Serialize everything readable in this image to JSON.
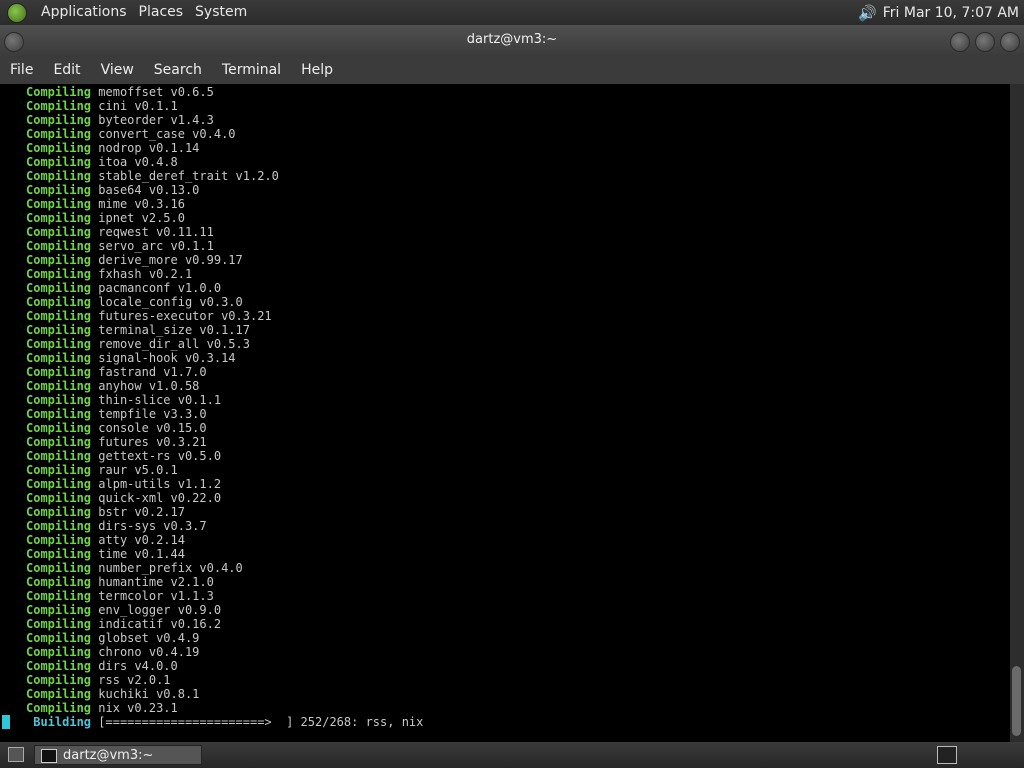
{
  "top_panel": {
    "menus": [
      "Applications",
      "Places",
      "System"
    ],
    "clock": "Fri Mar 10,  7:07 AM"
  },
  "window": {
    "title": "dartz@vm3:~",
    "menus": [
      "File",
      "Edit",
      "View",
      "Search",
      "Terminal",
      "Help"
    ]
  },
  "terminal": {
    "lines": [
      {
        "kw": "Compiling",
        "text": "memoffset v0.6.5"
      },
      {
        "kw": "Compiling",
        "text": "cini v0.1.1"
      },
      {
        "kw": "Compiling",
        "text": "byteorder v1.4.3"
      },
      {
        "kw": "Compiling",
        "text": "convert_case v0.4.0"
      },
      {
        "kw": "Compiling",
        "text": "nodrop v0.1.14"
      },
      {
        "kw": "Compiling",
        "text": "itoa v0.4.8"
      },
      {
        "kw": "Compiling",
        "text": "stable_deref_trait v1.2.0"
      },
      {
        "kw": "Compiling",
        "text": "base64 v0.13.0"
      },
      {
        "kw": "Compiling",
        "text": "mime v0.3.16"
      },
      {
        "kw": "Compiling",
        "text": "ipnet v2.5.0"
      },
      {
        "kw": "Compiling",
        "text": "reqwest v0.11.11"
      },
      {
        "kw": "Compiling",
        "text": "servo_arc v0.1.1"
      },
      {
        "kw": "Compiling",
        "text": "derive_more v0.99.17"
      },
      {
        "kw": "Compiling",
        "text": "fxhash v0.2.1"
      },
      {
        "kw": "Compiling",
        "text": "pacmanconf v1.0.0"
      },
      {
        "kw": "Compiling",
        "text": "locale_config v0.3.0"
      },
      {
        "kw": "Compiling",
        "text": "futures-executor v0.3.21"
      },
      {
        "kw": "Compiling",
        "text": "terminal_size v0.1.17"
      },
      {
        "kw": "Compiling",
        "text": "remove_dir_all v0.5.3"
      },
      {
        "kw": "Compiling",
        "text": "signal-hook v0.3.14"
      },
      {
        "kw": "Compiling",
        "text": "fastrand v1.7.0"
      },
      {
        "kw": "Compiling",
        "text": "anyhow v1.0.58"
      },
      {
        "kw": "Compiling",
        "text": "thin-slice v0.1.1"
      },
      {
        "kw": "Compiling",
        "text": "tempfile v3.3.0"
      },
      {
        "kw": "Compiling",
        "text": "console v0.15.0"
      },
      {
        "kw": "Compiling",
        "text": "futures v0.3.21"
      },
      {
        "kw": "Compiling",
        "text": "gettext-rs v0.5.0"
      },
      {
        "kw": "Compiling",
        "text": "raur v5.0.1"
      },
      {
        "kw": "Compiling",
        "text": "alpm-utils v1.1.2"
      },
      {
        "kw": "Compiling",
        "text": "quick-xml v0.22.0"
      },
      {
        "kw": "Compiling",
        "text": "bstr v0.2.17"
      },
      {
        "kw": "Compiling",
        "text": "dirs-sys v0.3.7"
      },
      {
        "kw": "Compiling",
        "text": "atty v0.2.14"
      },
      {
        "kw": "Compiling",
        "text": "time v0.1.44"
      },
      {
        "kw": "Compiling",
        "text": "number_prefix v0.4.0"
      },
      {
        "kw": "Compiling",
        "text": "humantime v2.1.0"
      },
      {
        "kw": "Compiling",
        "text": "termcolor v1.1.3"
      },
      {
        "kw": "Compiling",
        "text": "env_logger v0.9.0"
      },
      {
        "kw": "Compiling",
        "text": "indicatif v0.16.2"
      },
      {
        "kw": "Compiling",
        "text": "globset v0.4.9"
      },
      {
        "kw": "Compiling",
        "text": "chrono v0.4.19"
      },
      {
        "kw": "Compiling",
        "text": "dirs v4.0.0"
      },
      {
        "kw": "Compiling",
        "text": "rss v2.0.1"
      },
      {
        "kw": "Compiling",
        "text": "kuchiki v0.8.1"
      },
      {
        "kw": "Compiling",
        "text": "nix v0.23.1"
      },
      {
        "kw": " Building",
        "text": "[======================>  ] 252/268: rss, nix",
        "building": true
      }
    ]
  },
  "taskbar": {
    "task_label": "dartz@vm3:~"
  },
  "colors": {
    "compiling": "#6fd44a",
    "building": "#4fc3d8",
    "cursor": "#2fc7d5"
  }
}
